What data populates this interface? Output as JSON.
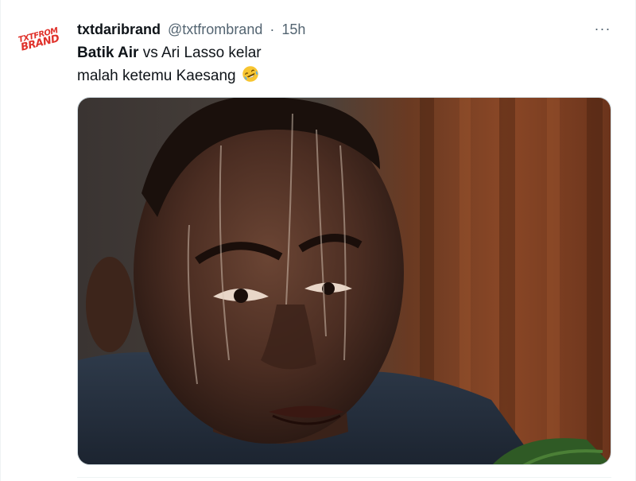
{
  "author": {
    "display_name": "txtdaribrand",
    "handle": "@txtfrombrand",
    "separator": "·",
    "timestamp": "15h",
    "avatar_logo_line1": "TXTFROM",
    "avatar_logo_line2": "BRAND"
  },
  "tweet": {
    "text_bold": "Batik Air",
    "text_rest_line1": " vs Ari Lasso kelar",
    "text_line2": "malah ketemu Kaesang",
    "emoji": "rolling-on-the-floor-laughing-emoji"
  },
  "more_button_label": "···",
  "media": {
    "kind": "photo"
  },
  "colors": {
    "text": "#0f1419",
    "secondary": "#536471",
    "border": "#cfd9de",
    "brand_red": "#e0312a"
  }
}
